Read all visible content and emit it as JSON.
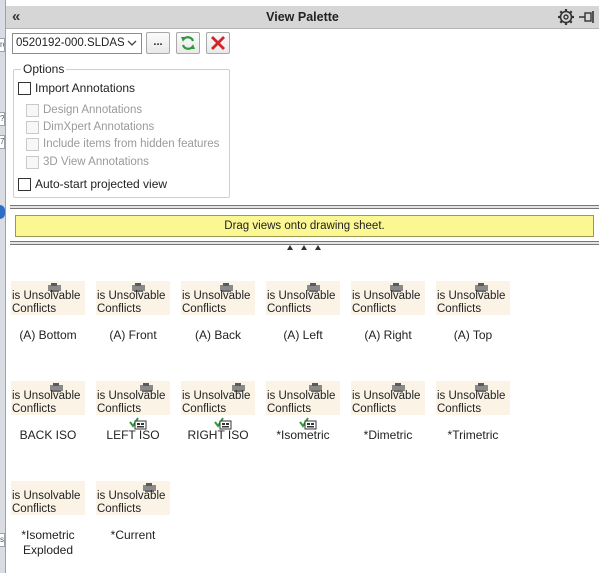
{
  "window": {
    "title": "View Palette"
  },
  "toolbar": {
    "file_name": "0520192-000.SLDASM",
    "browse_label": "..."
  },
  "options": {
    "legend": "Options",
    "import_annotations": "Import Annotations",
    "design_annotations": "Design Annotations",
    "dimxpert_annotations": "DimXpert Annotations",
    "hidden_features": "Include items from hidden features",
    "view_3d_annotations": "3D View Annotations",
    "auto_start": "Auto-start projected view"
  },
  "banner": {
    "text": "Drag views onto drawing sheet."
  },
  "thumb_error": {
    "line1": "is Unsolvable",
    "line2": "Conflicts"
  },
  "views": [
    {
      "label": "(A) Bottom",
      "checked": false
    },
    {
      "label": "(A) Front",
      "checked": false
    },
    {
      "label": "(A) Back",
      "checked": false
    },
    {
      "label": "(A) Left",
      "checked": false
    },
    {
      "label": "(A) Right",
      "checked": false
    },
    {
      "label": "(A) Top",
      "checked": false
    },
    {
      "label": "BACK ISO",
      "checked": false
    },
    {
      "label": "LEFT ISO",
      "checked": true
    },
    {
      "label": "RIGHT ISO",
      "checked": true
    },
    {
      "label": "*Isometric",
      "checked": true
    },
    {
      "label": "*Dimetric",
      "checked": false
    },
    {
      "label": "*Trimetric",
      "checked": false
    },
    {
      "label": "*Isometric\nExploded",
      "checked": false
    },
    {
      "label": "*Current",
      "checked": false
    }
  ],
  "left_strip": {
    "fragments": [
      "rc",
      "?",
      "7",
      "s"
    ]
  },
  "colors": {
    "banner_bg": "#fbf793",
    "titlebar_bg": "#d6d6d6",
    "close_red": "#d0262b",
    "refresh_green": "#2f9a3a"
  }
}
